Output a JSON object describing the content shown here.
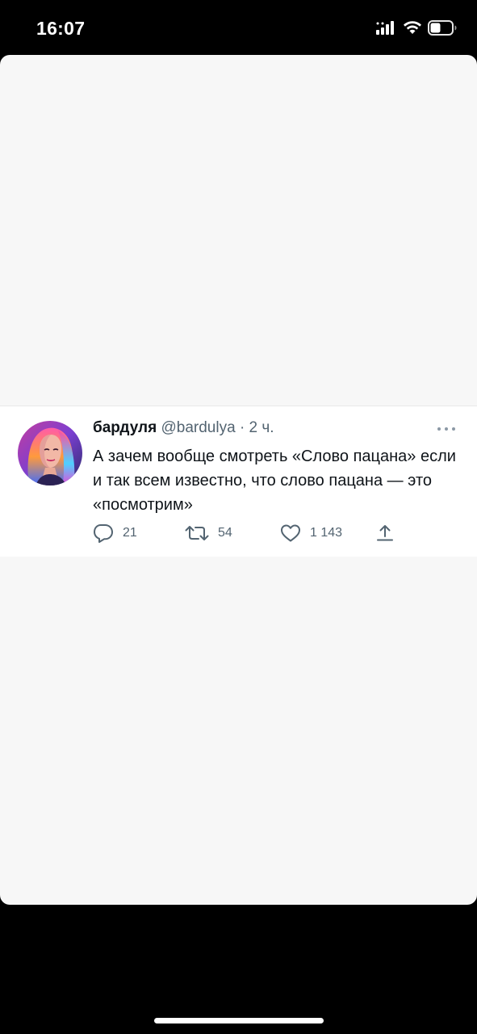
{
  "status_bar": {
    "time": "16:07",
    "signal_icon": "cellular-signal-icon",
    "wifi_icon": "wifi-icon",
    "battery_icon": "battery-icon",
    "battery_level": 0.35
  },
  "tweet": {
    "author": {
      "display_name": "бардуля",
      "handle": "@bardulya",
      "separator": "·",
      "time": "2 ч."
    },
    "text": "А зачем вообще смотреть «Слово пацана» если и так всем известно, что слово пацана — это «посмотрим»",
    "actions": {
      "reply_count": "21",
      "retweet_count": "54",
      "like_count": "1 143"
    },
    "icons": {
      "more": "more-icon",
      "reply": "reply-icon",
      "retweet": "retweet-icon",
      "like": "like-icon",
      "share": "share-icon"
    }
  },
  "colors": {
    "background": "#000000",
    "card": "#f7f7f7",
    "tweet_bg": "#ffffff",
    "text_primary": "#0f1419",
    "text_secondary": "#536471"
  }
}
